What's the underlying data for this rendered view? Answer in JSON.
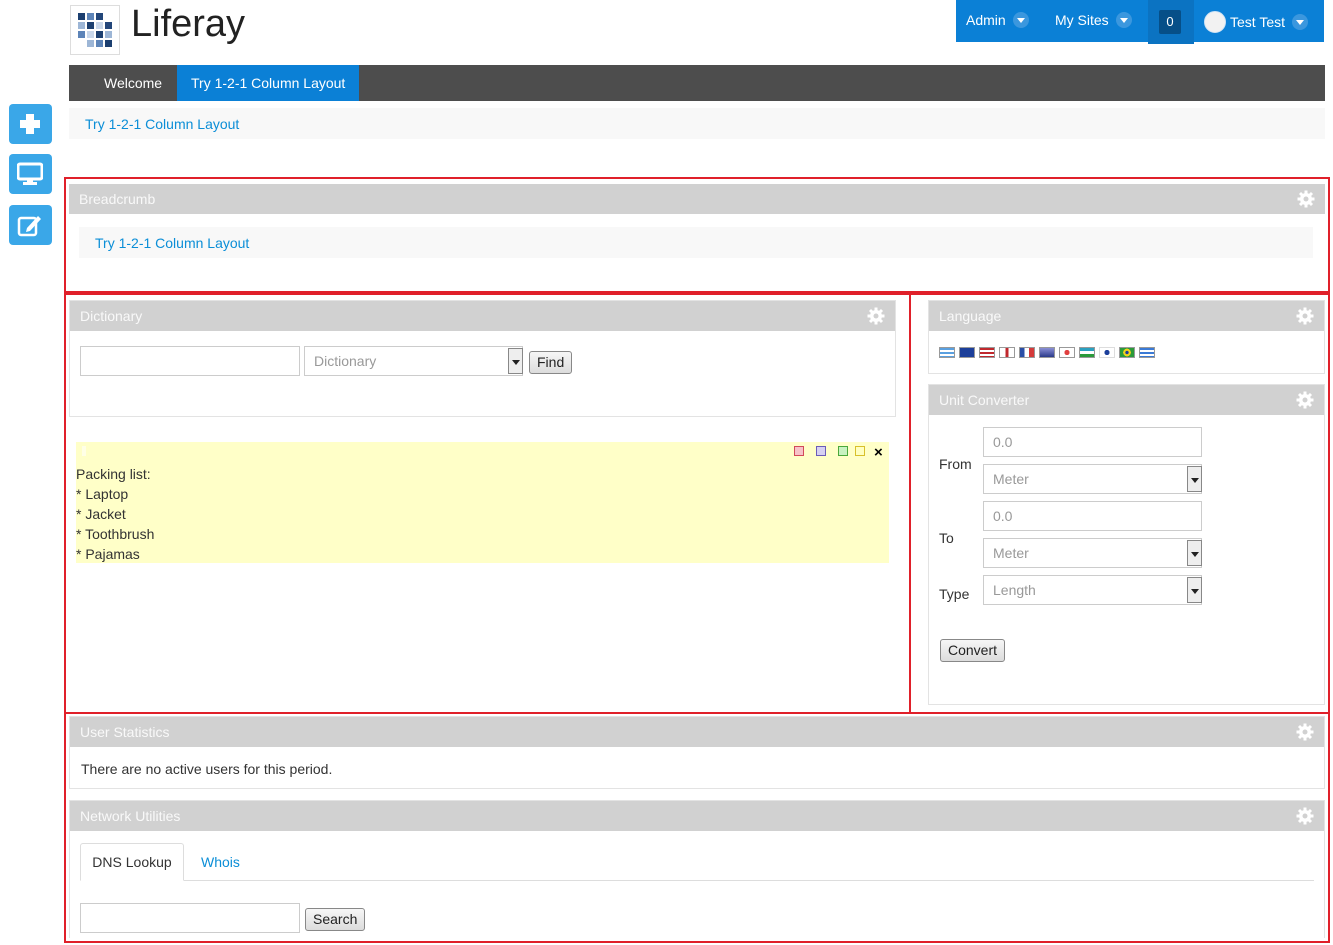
{
  "brand": {
    "name": "Liferay"
  },
  "dockbar": {
    "admin": "Admin",
    "my_sites": "My Sites",
    "notifications": "0",
    "user": "Test Test"
  },
  "nav": {
    "tabs": [
      {
        "label": "Welcome"
      },
      {
        "label": "Try 1-2-1 Column Layout"
      }
    ]
  },
  "breadcrumb_top": "Try 1-2-1 Column Layout",
  "portlets": {
    "breadcrumb": {
      "title": "Breadcrumb",
      "link": "Try 1-2-1 Column Layout"
    },
    "dictionary": {
      "title": "Dictionary",
      "input_value": "",
      "select_value": "Dictionary",
      "find_label": "Find"
    },
    "sticky_note": {
      "lines": [
        "Packing list:",
        "* Laptop",
        "* Jacket",
        "* Toothbrush",
        "* Pajamas"
      ],
      "colors": [
        "#f7c2c8",
        "#d6d0f2",
        "#c8f2c0",
        "#ffffc0"
      ],
      "close": "×"
    },
    "language": {
      "title": "Language"
    },
    "unit_converter": {
      "title": "Unit Converter",
      "from_label": "From",
      "to_label": "To",
      "type_label": "Type",
      "from_value": "0.0",
      "from_unit": "Meter",
      "to_value": "0.0",
      "to_unit": "Meter",
      "type_value": "Length",
      "convert_label": "Convert"
    },
    "user_statistics": {
      "title": "User Statistics",
      "message": "There are no active users for this period."
    },
    "network_utilities": {
      "title": "Network Utilities",
      "tabs": [
        "DNS Lookup",
        "Whois"
      ],
      "input_value": "",
      "search_label": "Search"
    }
  },
  "colors": {
    "accent": "#0b80d6",
    "nav_bg": "#4d4d4d",
    "portlet_title_bg": "#d1d1d1",
    "layout_outline": "#e0202a",
    "link": "#0b8ed7"
  }
}
